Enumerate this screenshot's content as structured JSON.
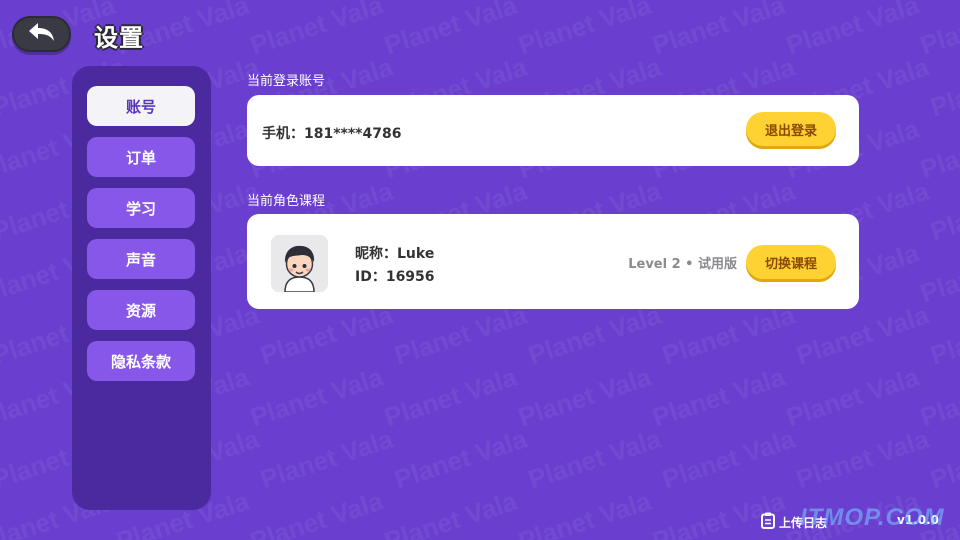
{
  "header": {
    "title": "设置"
  },
  "sidebar": {
    "items": [
      {
        "label": "账号",
        "active": true
      },
      {
        "label": "订单",
        "active": false
      },
      {
        "label": "学习",
        "active": false
      },
      {
        "label": "声音",
        "active": false
      },
      {
        "label": "资源",
        "active": false
      },
      {
        "label": "隐私条款",
        "active": false
      }
    ]
  },
  "account": {
    "section_label": "当前登录账号",
    "phone": "手机：181****4786",
    "logout_label": "退出登录"
  },
  "course": {
    "section_label": "当前角色课程",
    "nickname": "昵称：Luke",
    "id": "ID：16956",
    "level": "Level 2 • 试用版",
    "switch_label": "切换课程"
  },
  "footer": {
    "upload_log": "上传日志",
    "version": "v1.0.0"
  },
  "watermark": {
    "text": "Planet Vala",
    "site": "ITMOP.COM"
  },
  "colors": {
    "background": "#6a3fcf",
    "sidebar": "#4b2aa0",
    "sidebar_item": "#8657e8",
    "accent_button": "#ffd234"
  }
}
